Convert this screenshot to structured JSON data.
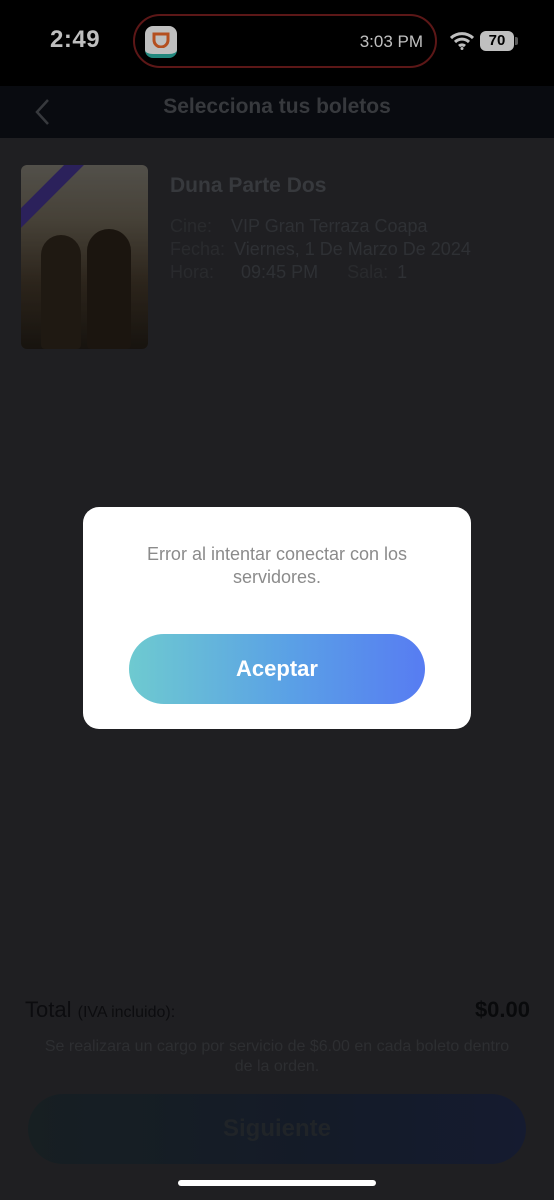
{
  "status_bar": {
    "time": "2:49",
    "live_activity_time": "3:03 PM",
    "battery": "70"
  },
  "header": {
    "title": "Selecciona tus boletos"
  },
  "movie": {
    "title": "Duna Parte Dos",
    "cinema_label": "Cine:",
    "cinema_value": "VIP Gran Terraza Coapa",
    "date_label": "Fecha:",
    "date_value": "Viernes, 1 De Marzo De 2024",
    "time_label": "Hora:",
    "time_value": "09:45 PM",
    "room_label": "Sala:",
    "room_value": "1"
  },
  "dialog": {
    "message": "Error al intentar conectar con los servidores.",
    "accept_label": "Aceptar"
  },
  "footer": {
    "total_label": "Total",
    "total_suffix": "(IVA incluido):",
    "total_value": "$0.00",
    "note": "Se realizara un cargo por servicio de $6.00 en cada boleto dentro de la orden.",
    "next_label": "Siguiente"
  },
  "colors": {
    "accent_gradient_start": "#6ecad0",
    "accent_gradient_end": "#577cf2"
  }
}
